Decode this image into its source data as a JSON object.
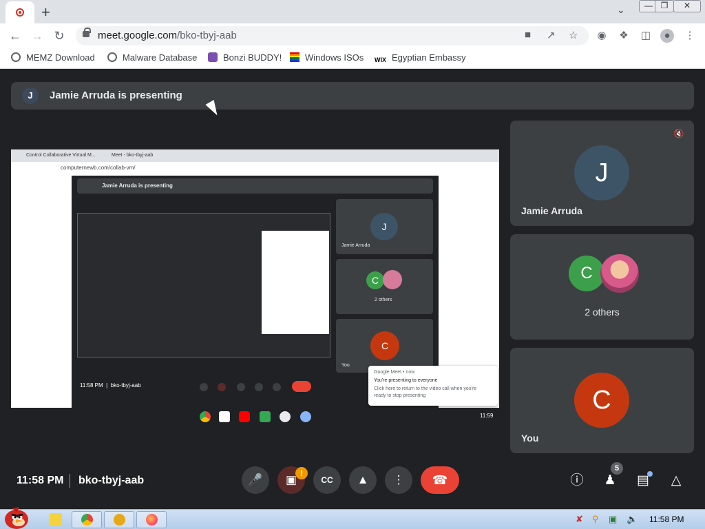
{
  "browser": {
    "url_host": "meet.google.com",
    "url_path": "/bko-tbyj-aab",
    "new_tab_label": "+",
    "bookmarks": [
      {
        "label": "MEMZ Download",
        "icon": "globe-icon"
      },
      {
        "label": "Malware Database",
        "icon": "globe-icon"
      },
      {
        "label": "Bonzi BUDDY!",
        "icon": "bonzi-icon"
      },
      {
        "label": "Windows ISOs",
        "icon": "rainbow-flag-icon"
      },
      {
        "label": "Egyptian Embassy",
        "icon": "wix-icon",
        "icon_text": "WIX"
      }
    ]
  },
  "meet": {
    "presenter_initial": "J",
    "presenting_banner": "Jamie Arruda is presenting",
    "time": "11:58 PM",
    "meeting_code": "bko-tbyj-aab",
    "people_count": "5",
    "camera_warning": "!",
    "tiles": [
      {
        "initial": "J",
        "name": "Jamie Arruda",
        "color": "#3c5466",
        "muted": true
      },
      {
        "initial": "C",
        "name": "2 others",
        "color": "#3ca04a"
      },
      {
        "initial": "C",
        "name": "You",
        "color": "#c5380f"
      }
    ]
  },
  "shared_screen": {
    "tab1": "Control Collaborative Virtual M...",
    "tab2": "Meet - bko-tbyj-aab",
    "url": "computernewb.com/collab-vm/",
    "banner": "Jamie Arruda is presenting",
    "thumb1_initial": "J",
    "thumb1_name": "Jamie Arruda",
    "thumb2_initial": "C",
    "thumb2_name": "2 others",
    "thumb3_initial": "C",
    "thumb3_name": "You",
    "inner_time": "11:58 PM",
    "inner_code": "bko-tbyj-aab",
    "notif_source": "Google Meet • now",
    "notif_title": "You're presenting to everyone",
    "notif_body1": "Click here to return to the video call when you're",
    "notif_body2": "ready to stop presenting",
    "shelf_time": "11:59"
  },
  "taskbar": {
    "time": "11:58 PM",
    "apps": [
      "chrome-icon",
      "xbox-icon",
      "firefox-icon"
    ]
  },
  "colors": {
    "meet_bg": "#202124",
    "tile_bg": "#3c4043",
    "hangup": "#ea4335",
    "warning": "#f29900"
  }
}
